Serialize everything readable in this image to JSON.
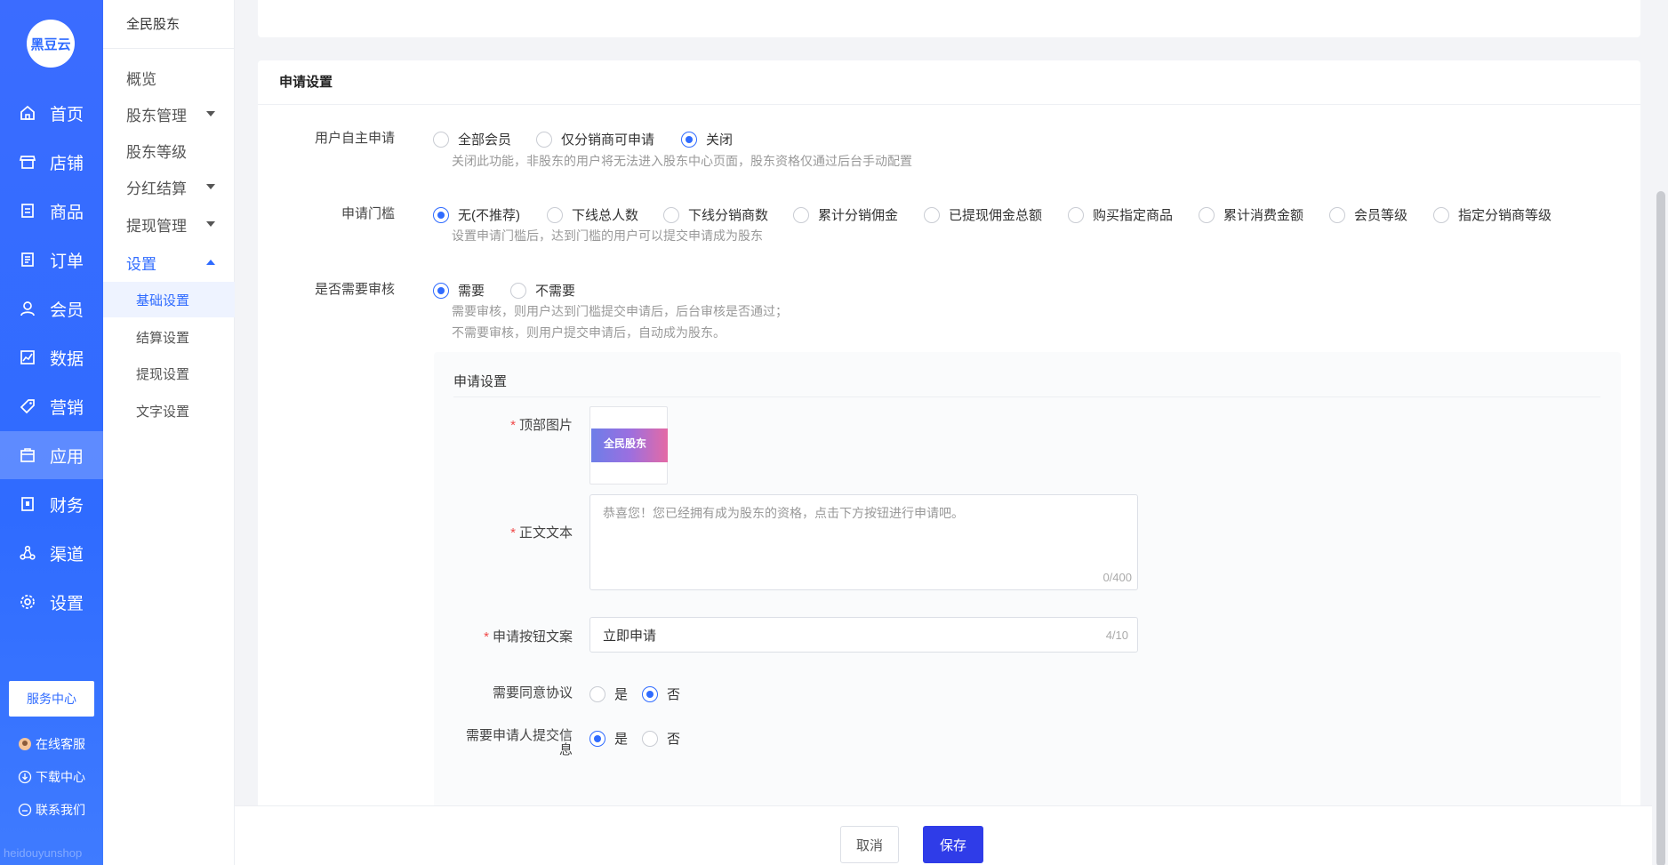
{
  "nav": {
    "logo": "黑豆云",
    "items": [
      {
        "label": "首页",
        "icon": "home-icon"
      },
      {
        "label": "店铺",
        "icon": "store-icon"
      },
      {
        "label": "商品",
        "icon": "goods-icon"
      },
      {
        "label": "订单",
        "icon": "order-icon"
      },
      {
        "label": "会员",
        "icon": "member-icon"
      },
      {
        "label": "数据",
        "icon": "data-icon"
      },
      {
        "label": "营销",
        "icon": "tag-icon"
      },
      {
        "label": "应用",
        "icon": "app-icon"
      },
      {
        "label": "财务",
        "icon": "finance-icon"
      },
      {
        "label": "渠道",
        "icon": "channel-icon"
      },
      {
        "label": "设置",
        "icon": "gear-icon"
      }
    ],
    "active_index": 7,
    "service_center": "服务中心",
    "links": [
      {
        "label": "在线客服",
        "icon": "service-avatar-icon"
      },
      {
        "label": "下载中心",
        "icon": "download-icon"
      },
      {
        "label": "联系我们",
        "icon": "contact-icon"
      }
    ],
    "watermark": "heidouyunshop"
  },
  "sub": {
    "title": "全民股东",
    "items": [
      {
        "label": "概览",
        "caret": false
      },
      {
        "label": "股东管理",
        "caret": true
      },
      {
        "label": "股东等级",
        "caret": false
      },
      {
        "label": "分红结算",
        "caret": true
      },
      {
        "label": "提现管理",
        "caret": true
      },
      {
        "label": "设置",
        "caret": true,
        "open": true
      }
    ],
    "children": [
      "基础设置",
      "结算设置",
      "提现设置",
      "文字设置"
    ],
    "active_child": 0
  },
  "main": {
    "section_title": "申请设置",
    "self_apply": {
      "label": "用户自主申请",
      "options": [
        "全部会员",
        "仅分销商可申请",
        "关闭"
      ],
      "selected": 2,
      "hint": "关闭此功能，非股东的用户将无法进入股东中心页面，股东资格仅通过后台手动配置"
    },
    "threshold": {
      "label": "申请门槛",
      "options": [
        "无(不推荐)",
        "下线总人数",
        "下线分销商数",
        "累计分销佣金",
        "已提现佣金总额",
        "购买指定商品",
        "累计消费金额",
        "会员等级",
        "指定分销商等级"
      ],
      "selected": 0,
      "hint": "设置申请门槛后，达到门槛的用户可以提交申请成为股东"
    },
    "review": {
      "label": "是否需要审核",
      "options": [
        "需要",
        "不需要"
      ],
      "selected": 0,
      "hint1": "需要审核，则用户达到门槛提交申请后，后台审核是否通过；",
      "hint2": "不需要审核，则用户提交申请后，自动成为股东。"
    },
    "panel": {
      "title": "申请设置",
      "top_image_label": "顶部图片",
      "top_image_text": "全民股东",
      "body_text_label": "正文文本",
      "body_text_placeholder": "恭喜您！您已经拥有成为股东的资格，点击下方按钮进行申请吧。",
      "body_text_count": "0/400",
      "button_text_label": "申请按钮文案",
      "button_text_value": "立即申请",
      "button_text_count": "4/10",
      "agree_label": "需要同意协议",
      "agree_options": [
        "是",
        "否"
      ],
      "agree_selected": 1,
      "submit_info_label_1": "需要申请人提交信",
      "submit_info_label_2": "息",
      "submit_info_options": [
        "是",
        "否"
      ],
      "submit_info_selected": 0
    }
  },
  "footer": {
    "cancel": "取消",
    "save": "保存"
  }
}
